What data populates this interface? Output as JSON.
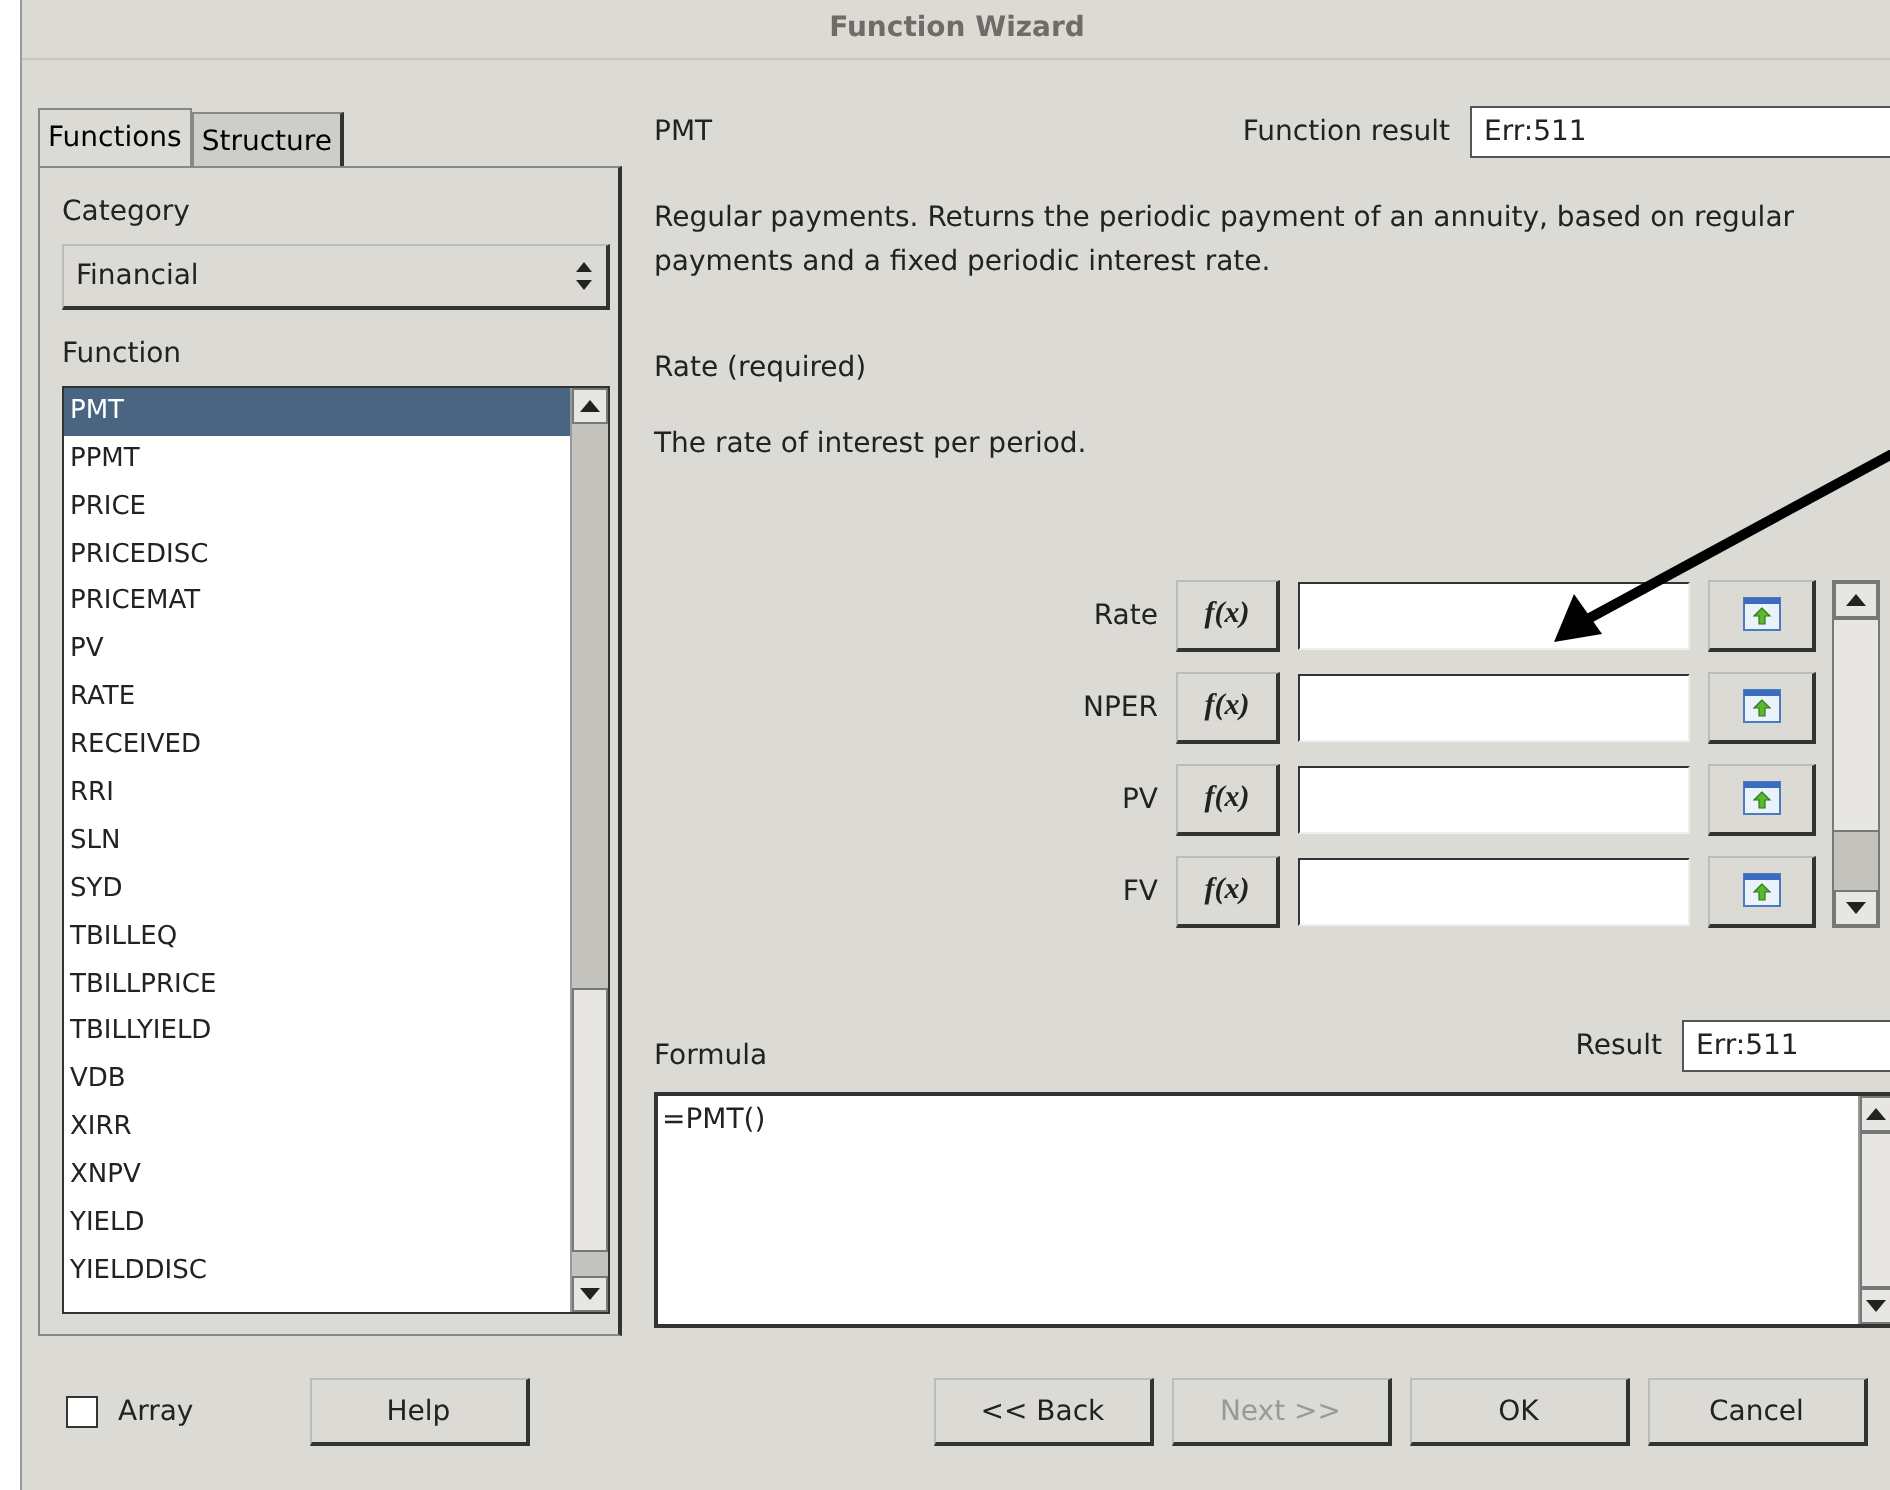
{
  "window": {
    "title": "Function Wizard"
  },
  "tabs": [
    {
      "label": "Functions",
      "selected": true
    },
    {
      "label": "Structure",
      "selected": false
    }
  ],
  "category": {
    "label": "Category",
    "value": "Financial"
  },
  "function_list": {
    "label": "Function",
    "items": [
      {
        "name": "PMT",
        "selected": true
      },
      {
        "name": "PPMT",
        "selected": false
      },
      {
        "name": "PRICE",
        "selected": false
      },
      {
        "name": "PRICEDISC",
        "selected": false
      },
      {
        "name": "PRICEMAT",
        "selected": false
      },
      {
        "name": "PV",
        "selected": false
      },
      {
        "name": "RATE",
        "selected": false
      },
      {
        "name": "RECEIVED",
        "selected": false
      },
      {
        "name": "RRI",
        "selected": false
      },
      {
        "name": "SLN",
        "selected": false
      },
      {
        "name": "SYD",
        "selected": false
      },
      {
        "name": "TBILLEQ",
        "selected": false
      },
      {
        "name": "TBILLPRICE",
        "selected": false
      },
      {
        "name": "TBILLYIELD",
        "selected": false
      },
      {
        "name": "VDB",
        "selected": false
      },
      {
        "name": "XIRR",
        "selected": false
      },
      {
        "name": "XNPV",
        "selected": false
      },
      {
        "name": "YIELD",
        "selected": false
      },
      {
        "name": "YIELDDISC",
        "selected": false
      }
    ]
  },
  "function_name": "PMT",
  "function_result": {
    "label": "Function result",
    "value": "Err:511"
  },
  "description": "Regular payments. Returns the periodic payment of an annuity, based on regular payments and a fixed periodic interest rate.",
  "argument_title": "Rate (required)",
  "argument_description": "The rate of interest per period.",
  "arguments": [
    {
      "label": "Rate",
      "button": "f(x)"
    },
    {
      "label": "NPER",
      "button": "f(x)"
    },
    {
      "label": "PV",
      "button": "f(x)"
    },
    {
      "label": "FV",
      "button": "f(x)"
    }
  ],
  "result": {
    "label": "Result",
    "value": "Err:511"
  },
  "formula": {
    "label": "Formula",
    "value": "=PMT()"
  },
  "array": {
    "label": "Array",
    "checked": false
  },
  "help_button": {
    "label": "Help"
  },
  "buttons": [
    {
      "label": "<< Back",
      "disabled": false
    },
    {
      "label": "Next >>",
      "disabled": true
    },
    {
      "label": "OK",
      "disabled": false
    },
    {
      "label": "Cancel",
      "disabled": false
    }
  ]
}
